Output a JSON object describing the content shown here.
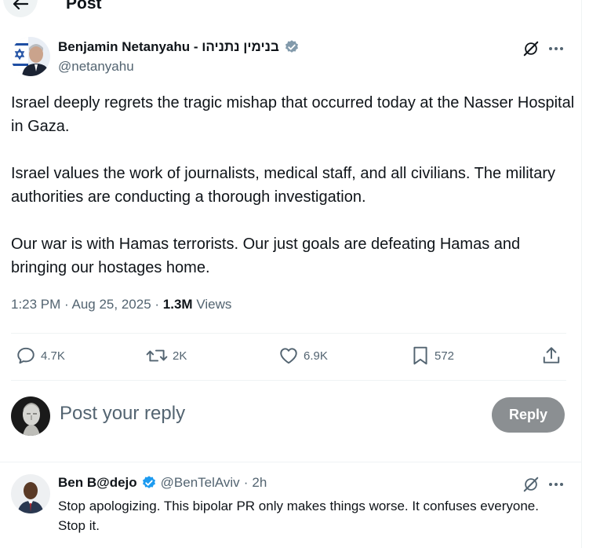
{
  "header": {
    "title": "Post",
    "back_icon": "arrow-left-icon"
  },
  "tweet": {
    "author_name": "Benjamin Netanyahu - בנימין נתניהו",
    "handle": "@netanyahu",
    "verified_color": "#829aab",
    "paragraphs": [
      "Israel deeply regrets the tragic mishap that occurred today at the Nasser Hospital in Gaza.",
      "Israel values the work of journalists, medical staff, and all civilians. The military authorities are conducting a thorough investigation.",
      "Our war is with Hamas terrorists. Our just goals are defeating Hamas and bringing our hostages home."
    ],
    "time": "1:23 PM",
    "date": "Aug 25, 2025",
    "views_count": "1.3M",
    "views_label": "Views",
    "actions": {
      "replies": "4.7K",
      "reposts": "2K",
      "likes": "6.9K",
      "bookmarks": "572"
    }
  },
  "composer": {
    "placeholder": "Post your reply",
    "button_label": "Reply",
    "button_color": "#8b8f92"
  },
  "reply": {
    "name": "Ben B@dejo",
    "handle": "@BenTelAviv",
    "time": "2h",
    "verified_color": "#1d9bf0",
    "text": "Stop apologizing. This bipolar PR only makes things worse. It confuses everyone. Stop it."
  }
}
